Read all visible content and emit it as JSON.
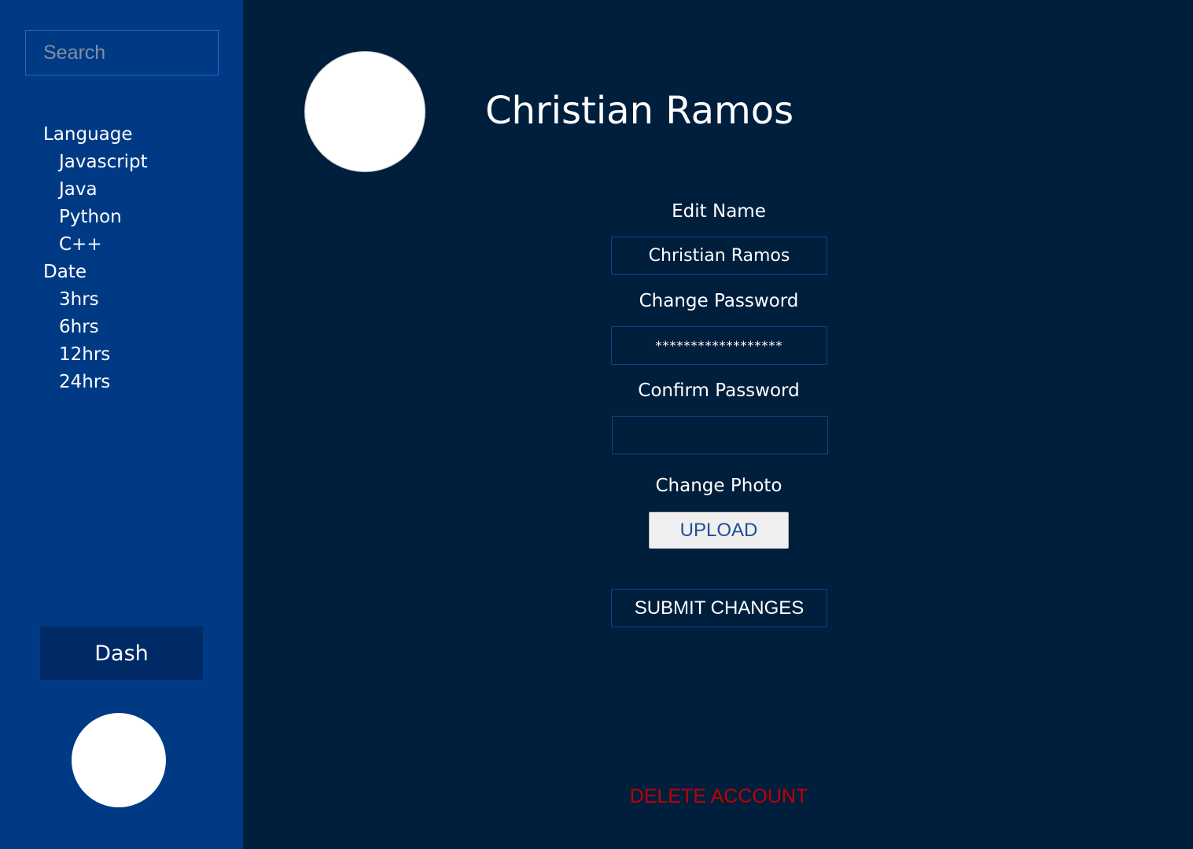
{
  "sidebar": {
    "search_placeholder": "Search",
    "filters": {
      "language_label": "Language",
      "languages": [
        "Javascript",
        "Java",
        "Python",
        "C++"
      ],
      "date_label": "Date",
      "dates": [
        "3hrs",
        "6hrs",
        "12hrs",
        "24hrs"
      ]
    },
    "dash_label": "Dash"
  },
  "profile": {
    "name": "Christian Ramos"
  },
  "form": {
    "edit_name_label": "Edit Name",
    "name_value": "Christian Ramos",
    "change_password_label": "Change Password",
    "password_value": "******************",
    "confirm_password_label": "Confirm Password",
    "confirm_password_value": "",
    "change_photo_label": "Change Photo",
    "upload_label": "UPLOAD",
    "submit_label": "SUBMIT CHANGES",
    "delete_label": "DELETE ACCOUNT"
  },
  "colors": {
    "sidebar_bg": "#003a85",
    "main_bg": "#001f3d",
    "dash_bg": "#002a66",
    "delete_red": "#c00000",
    "upload_text": "#1f4d9a"
  }
}
